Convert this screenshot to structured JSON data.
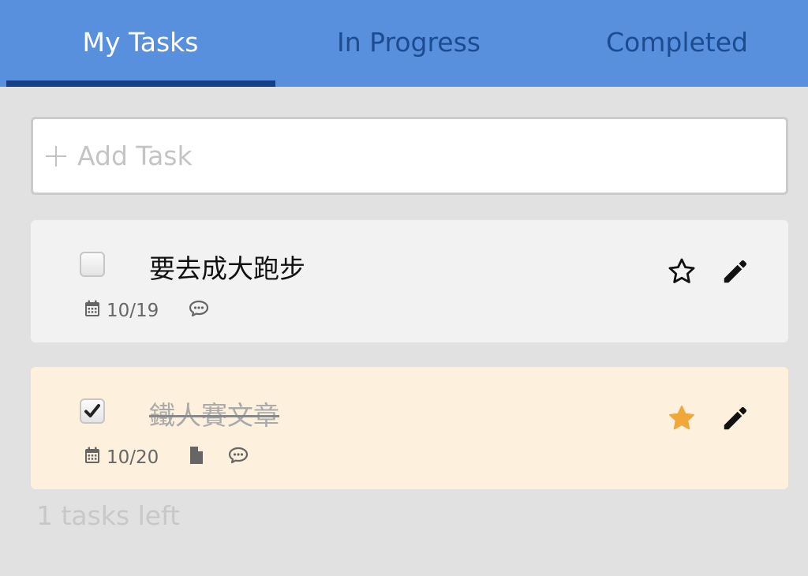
{
  "tabs": [
    {
      "label": "My Tasks",
      "active": true
    },
    {
      "label": "In Progress",
      "active": false
    },
    {
      "label": "Completed",
      "active": false
    }
  ],
  "add_task": {
    "placeholder": "Add Task",
    "value": ""
  },
  "tasks": [
    {
      "title": "要去成大跑步",
      "completed": false,
      "starred": false,
      "date": "10/19",
      "icons": [
        "calendar-icon",
        "comment-icon"
      ]
    },
    {
      "title": "鐵人賽文章",
      "completed": true,
      "starred": true,
      "date": "10/20",
      "icons": [
        "calendar-icon",
        "file-icon",
        "comment-icon"
      ]
    }
  ],
  "footer": {
    "tasks_left": "1 tasks left"
  },
  "colors": {
    "header": "#5990dd",
    "active_tab_text": "#ffffff",
    "inactive_tab_text": "#1c4c8f",
    "tab_underline": "#153f86",
    "background": "#e1e1e1",
    "task_card": "#f2f2f2",
    "completed_task_card": "#fdf1de",
    "star_active": "#f0a83a"
  }
}
